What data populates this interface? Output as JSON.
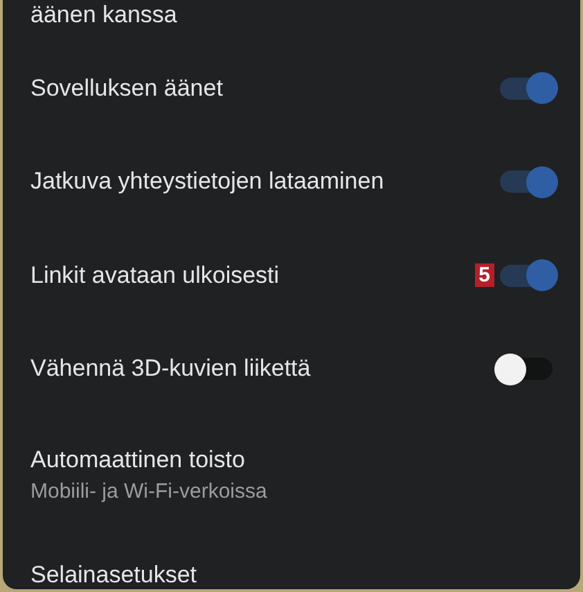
{
  "items": [
    {
      "kind": "text",
      "label": "äänen kanssa"
    },
    {
      "kind": "toggle",
      "label": "Sovelluksen äänet",
      "on": true
    },
    {
      "kind": "toggle",
      "label": "Jatkuva yhteystietojen lataaminen",
      "on": true
    },
    {
      "kind": "toggle",
      "label": "Linkit avataan ulkoisesti",
      "on": true,
      "badge": "5"
    },
    {
      "kind": "toggle",
      "label": "Vähennä 3D-kuvien liikettä",
      "on": false
    },
    {
      "kind": "link",
      "label": "Automaattinen toisto",
      "subtitle": "Mobiili- ja Wi-Fi-verkoissa"
    },
    {
      "kind": "link",
      "label": "Selainasetukset"
    }
  ]
}
